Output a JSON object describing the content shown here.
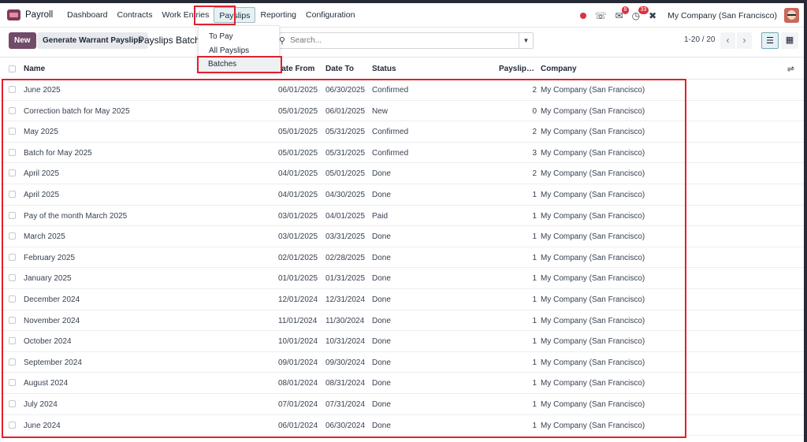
{
  "navbar": {
    "app_name": "Payroll",
    "menu": [
      "Dashboard",
      "Contracts",
      "Work Entries",
      "Payslips",
      "Reporting",
      "Configuration"
    ],
    "active_menu": "Payslips",
    "company": "My Company (San Francisco)",
    "chat_badge": "8",
    "activity_badge": "33",
    "icons": [
      "phone-icon",
      "chat-icon",
      "clock-icon",
      "tools-icon"
    ]
  },
  "control": {
    "new_label": "New",
    "generate_label": "Generate Warrant Payslips",
    "breadcrumb": "Payslips Batches",
    "search_placeholder": "Search...",
    "pager": "1-20 / 20"
  },
  "payslips_menu": {
    "items": [
      "To Pay",
      "All Payslips",
      "Batches"
    ],
    "highlighted": "Batches"
  },
  "table": {
    "headers": {
      "name": "Name",
      "date_from": "Date From",
      "date_to": "Date To",
      "status": "Status",
      "payslips": "Payslips Count",
      "company": "Company"
    },
    "rows": [
      {
        "name": "June 2025",
        "from": "06/01/2025",
        "to": "06/30/2025",
        "status": "Confirmed",
        "count": "2",
        "company": "My Company (San Francisco)"
      },
      {
        "name": "Correction batch for May 2025",
        "from": "05/01/2025",
        "to": "06/01/2025",
        "status": "New",
        "count": "0",
        "company": "My Company (San Francisco)"
      },
      {
        "name": "May 2025",
        "from": "05/01/2025",
        "to": "05/31/2025",
        "status": "Confirmed",
        "count": "2",
        "company": "My Company (San Francisco)"
      },
      {
        "name": "Batch for May 2025",
        "from": "05/01/2025",
        "to": "05/31/2025",
        "status": "Confirmed",
        "count": "3",
        "company": "My Company (San Francisco)"
      },
      {
        "name": "April 2025",
        "from": "04/01/2025",
        "to": "05/01/2025",
        "status": "Done",
        "count": "2",
        "company": "My Company (San Francisco)"
      },
      {
        "name": "April 2025",
        "from": "04/01/2025",
        "to": "04/30/2025",
        "status": "Done",
        "count": "1",
        "company": "My Company (San Francisco)"
      },
      {
        "name": "Pay of the month March 2025",
        "from": "03/01/2025",
        "to": "04/01/2025",
        "status": "Paid",
        "count": "1",
        "company": "My Company (San Francisco)"
      },
      {
        "name": "March 2025",
        "from": "03/01/2025",
        "to": "03/31/2025",
        "status": "Done",
        "count": "1",
        "company": "My Company (San Francisco)"
      },
      {
        "name": "February 2025",
        "from": "02/01/2025",
        "to": "02/28/2025",
        "status": "Done",
        "count": "1",
        "company": "My Company (San Francisco)"
      },
      {
        "name": "January 2025",
        "from": "01/01/2025",
        "to": "01/31/2025",
        "status": "Done",
        "count": "1",
        "company": "My Company (San Francisco)"
      },
      {
        "name": "December 2024",
        "from": "12/01/2024",
        "to": "12/31/2024",
        "status": "Done",
        "count": "1",
        "company": "My Company (San Francisco)"
      },
      {
        "name": "November 2024",
        "from": "11/01/2024",
        "to": "11/30/2024",
        "status": "Done",
        "count": "1",
        "company": "My Company (San Francisco)"
      },
      {
        "name": "October 2024",
        "from": "10/01/2024",
        "to": "10/31/2024",
        "status": "Done",
        "count": "1",
        "company": "My Company (San Francisco)"
      },
      {
        "name": "September 2024",
        "from": "09/01/2024",
        "to": "09/30/2024",
        "status": "Done",
        "count": "1",
        "company": "My Company (San Francisco)"
      },
      {
        "name": "August 2024",
        "from": "08/01/2024",
        "to": "08/31/2024",
        "status": "Done",
        "count": "1",
        "company": "My Company (San Francisco)"
      },
      {
        "name": "July 2024",
        "from": "07/01/2024",
        "to": "07/31/2024",
        "status": "Done",
        "count": "1",
        "company": "My Company (San Francisco)"
      },
      {
        "name": "June 2024",
        "from": "06/01/2024",
        "to": "06/30/2024",
        "status": "Done",
        "count": "1",
        "company": "My Company (San Francisco)"
      }
    ]
  },
  "colors": {
    "brand": "#714b67",
    "highlight": "#e0202e",
    "active_tab_bg": "#e6f1f4"
  }
}
